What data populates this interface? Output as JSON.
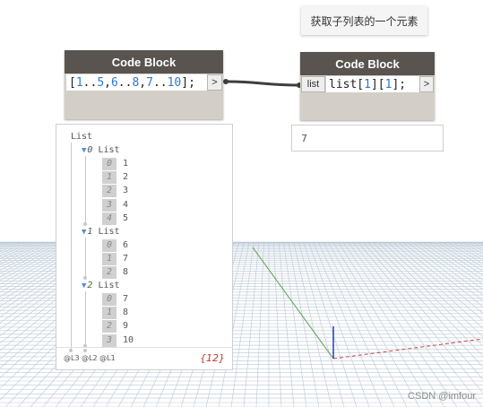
{
  "note": {
    "text": "获取子列表的一个元素"
  },
  "node1": {
    "title": "Code Block",
    "code_parts": [
      {
        "t": "[",
        "c": "p"
      },
      {
        "t": "1",
        "c": "n"
      },
      {
        "t": "..",
        "c": "p"
      },
      {
        "t": "5",
        "c": "n"
      },
      {
        "t": ",",
        "c": "p"
      },
      {
        "t": "6",
        "c": "n"
      },
      {
        "t": "..",
        "c": "p"
      },
      {
        "t": "8",
        "c": "n"
      },
      {
        "t": ",",
        "c": "p"
      },
      {
        "t": "7",
        "c": "n"
      },
      {
        "t": "..",
        "c": "p"
      },
      {
        "t": "10",
        "c": "n"
      },
      {
        "t": "];",
        "c": "p"
      }
    ],
    "out_port": ">"
  },
  "node2": {
    "title": "Code Block",
    "in_port": "list",
    "code_parts": [
      {
        "t": "list[",
        "c": "p"
      },
      {
        "t": "1",
        "c": "n"
      },
      {
        "t": "][",
        "c": "p"
      },
      {
        "t": "1",
        "c": "n"
      },
      {
        "t": "];",
        "c": "p"
      }
    ],
    "out_port": ">"
  },
  "watch": {
    "root_label": "List",
    "sublists": [
      {
        "index": "0",
        "label": "List",
        "items": [
          {
            "i": "0",
            "v": "1"
          },
          {
            "i": "1",
            "v": "2"
          },
          {
            "i": "2",
            "v": "3"
          },
          {
            "i": "3",
            "v": "4"
          },
          {
            "i": "4",
            "v": "5"
          }
        ]
      },
      {
        "index": "1",
        "label": "List",
        "items": [
          {
            "i": "0",
            "v": "6"
          },
          {
            "i": "1",
            "v": "7"
          },
          {
            "i": "2",
            "v": "8"
          }
        ]
      },
      {
        "index": "2",
        "label": "List",
        "items": [
          {
            "i": "0",
            "v": "7"
          },
          {
            "i": "1",
            "v": "8"
          },
          {
            "i": "2",
            "v": "9"
          },
          {
            "i": "3",
            "v": "10"
          }
        ]
      }
    ],
    "levels": "@L3 @L2 @L1",
    "count": "{12}"
  },
  "output_preview": {
    "value": "7"
  },
  "watermark": "CSDN @imfour"
}
